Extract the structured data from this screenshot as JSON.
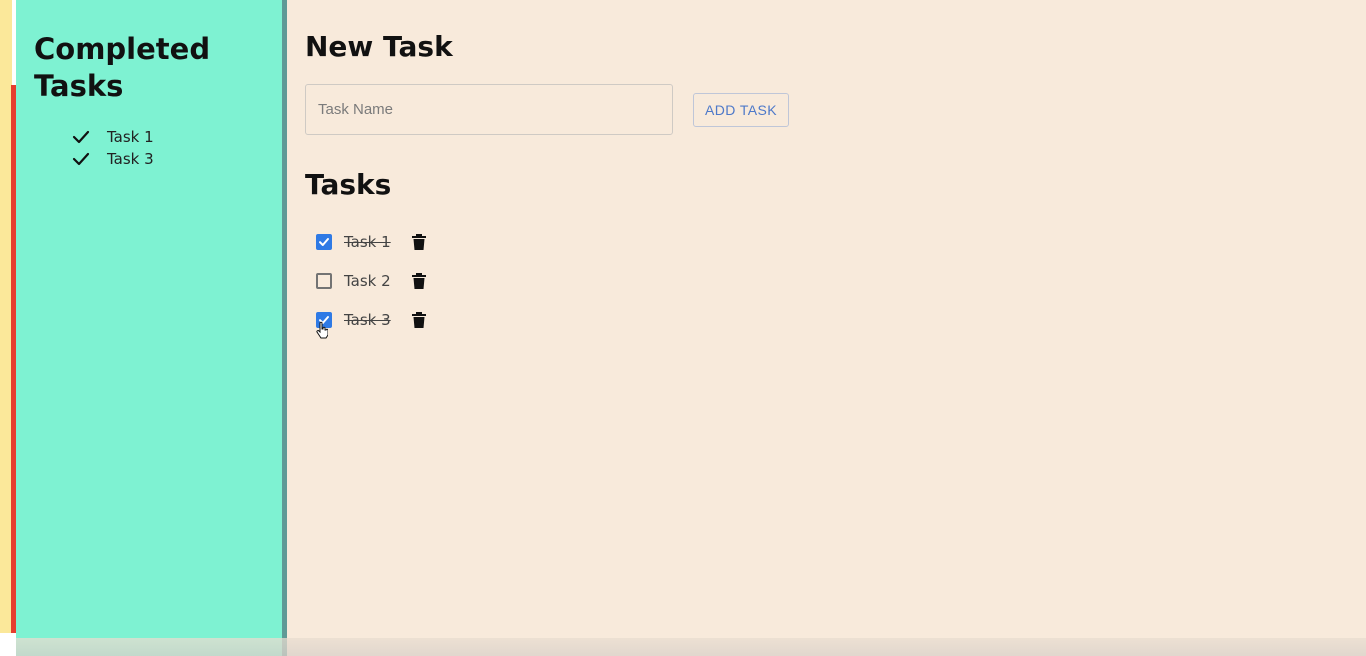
{
  "sidebar": {
    "title": "Completed Tasks",
    "completed_items": [
      "Task 1",
      "Task 3"
    ]
  },
  "main": {
    "new_task_title": "New Task",
    "input_placeholder": "Task Name",
    "input_value": "",
    "add_button_label": "ADD TASK",
    "tasks_title": "Tasks",
    "tasks": [
      {
        "label": "Task 1",
        "completed": true
      },
      {
        "label": "Task 2",
        "completed": false
      },
      {
        "label": "Task 3",
        "completed": true
      }
    ]
  },
  "colors": {
    "sidebar_bg": "#7ef2d2",
    "main_bg": "#f8eadb",
    "accent": "#2f7ae5",
    "button_text": "#4e79c9"
  },
  "icons": {
    "check": "check-icon",
    "trash": "trash-icon",
    "cursor": "cursor-icon"
  }
}
